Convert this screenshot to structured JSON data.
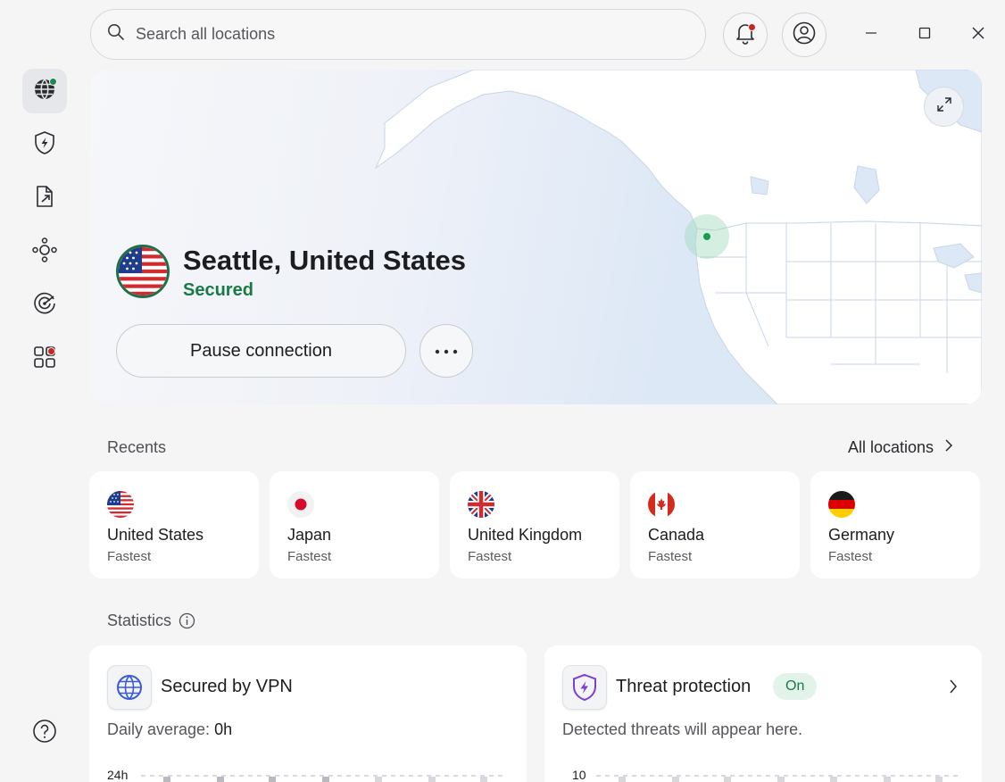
{
  "search": {
    "placeholder": "Search all locations"
  },
  "sidebar": {
    "items": [
      {
        "name": "globe-icon",
        "active": true,
        "badge": "green"
      },
      {
        "name": "shield-bolt-icon"
      },
      {
        "name": "file-share-icon"
      },
      {
        "name": "mesh-network-icon"
      },
      {
        "name": "radar-target-icon"
      },
      {
        "name": "apps-grid-icon",
        "badge": "red"
      }
    ],
    "help_icon": "help-icon"
  },
  "connection": {
    "location": "Seattle, United States",
    "status": "Secured",
    "pause_label": "Pause connection"
  },
  "recents": {
    "label": "Recents",
    "all_locations_label": "All locations",
    "items": [
      {
        "country": "United States",
        "sub": "Fastest"
      },
      {
        "country": "Japan",
        "sub": "Fastest"
      },
      {
        "country": "United Kingdom",
        "sub": "Fastest"
      },
      {
        "country": "Canada",
        "sub": "Fastest"
      },
      {
        "country": "Germany",
        "sub": "Fastest"
      }
    ]
  },
  "statistics": {
    "label": "Statistics",
    "vpn": {
      "title": "Secured by VPN",
      "daily_label": "Daily average:",
      "daily_value": "0h",
      "axis_top": "24h"
    },
    "threat": {
      "title": "Threat protection",
      "badge": "On",
      "description": "Detected threats will appear here.",
      "axis_top": "10"
    }
  },
  "colors": {
    "accent_green": "#1a7a45",
    "notification_red": "#c6281e",
    "map_land": "#ffffff",
    "map_water": "#dde8f6"
  }
}
